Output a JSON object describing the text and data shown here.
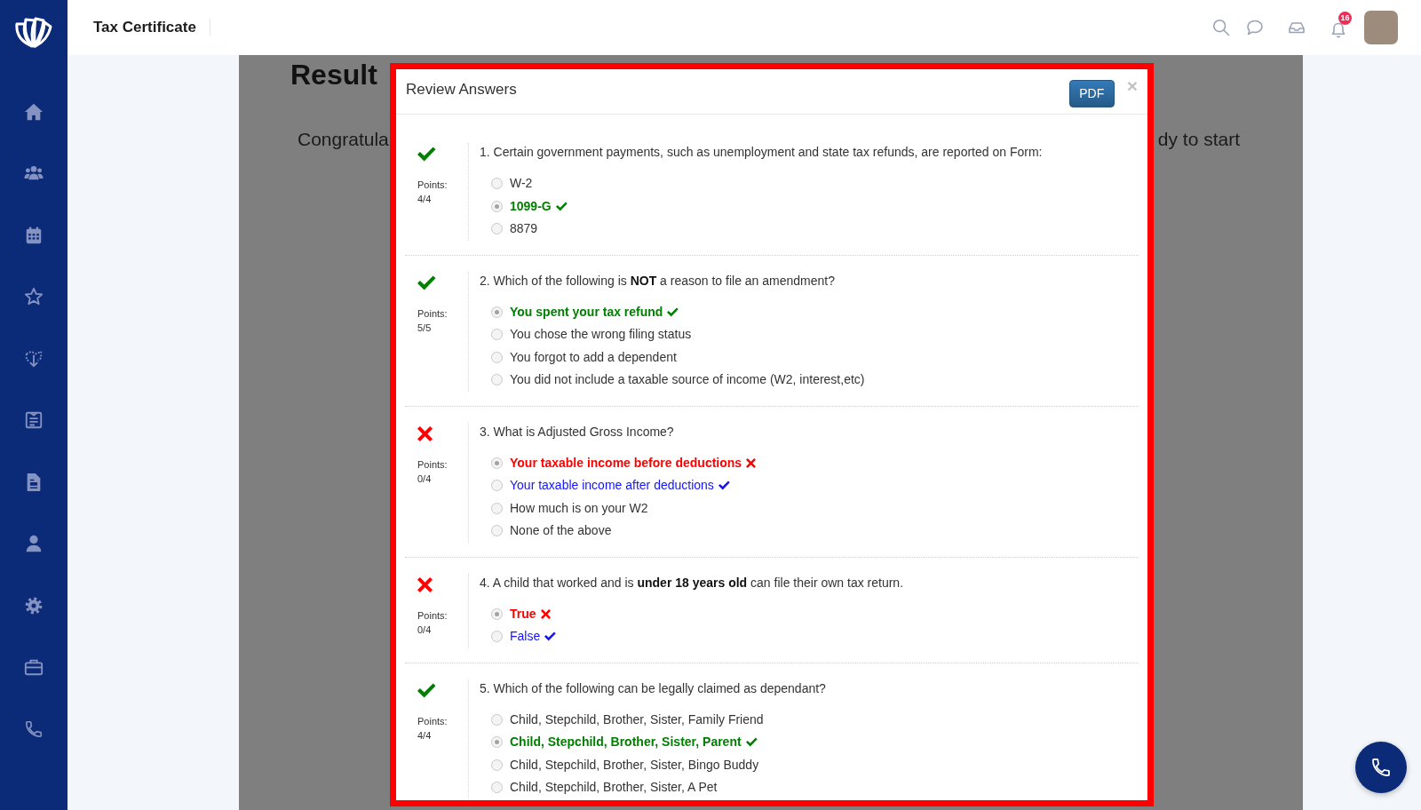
{
  "header": {
    "title": "Tax Certificate",
    "notification_count": "16"
  },
  "page": {
    "heading": "Result",
    "text_left": "Congratula",
    "text_right": "dy to start"
  },
  "dialog": {
    "title": "Review Answers",
    "pdf_button": "PDF",
    "close_button": "×",
    "questions": [
      {
        "text": "1. Certain government payments, such as unemployment and state tax refunds, are reported on Form:",
        "kind": "correct",
        "points_label": "Points:",
        "points": "4/4",
        "options": [
          {
            "label": "W-2",
            "selected": false,
            "kind": "plain"
          },
          {
            "label": "1099-G",
            "selected": true,
            "kind": "correct"
          },
          {
            "label": "8879",
            "selected": false,
            "kind": "plain"
          }
        ]
      },
      {
        "text": "2. Which of the following is **NOT** a reason to file an amendment?",
        "kind": "correct",
        "points_label": "Points:",
        "points": "5/5",
        "options": [
          {
            "label": "You spent your tax refund",
            "selected": true,
            "kind": "correct"
          },
          {
            "label": "You chose the wrong filing status",
            "selected": false,
            "kind": "plain"
          },
          {
            "label": "You forgot to add a dependent",
            "selected": false,
            "kind": "plain"
          },
          {
            "label": "You did not include a taxable source of income (W2, interest,etc)",
            "selected": false,
            "kind": "plain"
          }
        ]
      },
      {
        "text": "3. What is Adjusted Gross Income?",
        "kind": "wrong",
        "points_label": "Points:",
        "points": "0/4",
        "options": [
          {
            "label": "Your taxable income before deductions",
            "selected": true,
            "kind": "wrong"
          },
          {
            "label": "Your taxable income after deductions",
            "selected": false,
            "kind": "answer"
          },
          {
            "label": "How much is on your W2",
            "selected": false,
            "kind": "plain"
          },
          {
            "label": "None of the above",
            "selected": false,
            "kind": "plain"
          }
        ]
      },
      {
        "text": "4. A child that worked and is **under 18 years old** can file their own tax return.",
        "kind": "wrong",
        "points_label": "Points:",
        "points": "0/4",
        "options": [
          {
            "label": "True",
            "selected": true,
            "kind": "wrong"
          },
          {
            "label": "False",
            "selected": false,
            "kind": "answer"
          }
        ]
      },
      {
        "text": "5. Which of the following can be legally claimed as dependant?",
        "kind": "correct",
        "points_label": "Points:",
        "points": "4/4",
        "options": [
          {
            "label": "Child, Stepchild, Brother, Sister, Family Friend",
            "selected": false,
            "kind": "plain"
          },
          {
            "label": "Child, Stepchild, Brother, Sister, Parent",
            "selected": true,
            "kind": "correct"
          },
          {
            "label": "Child, Stepchild, Brother, Sister, Bingo Buddy",
            "selected": false,
            "kind": "plain"
          },
          {
            "label": "Child, Stepchild, Brother, Sister, A Pet",
            "selected": false,
            "kind": "plain"
          }
        ]
      }
    ]
  }
}
